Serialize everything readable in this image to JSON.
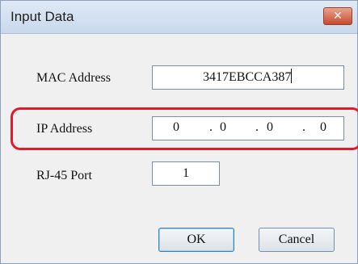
{
  "window": {
    "title": "Input Data",
    "close_glyph": "✕"
  },
  "form": {
    "mac": {
      "label": "MAC Address",
      "value": "3417EBCCA387"
    },
    "ip": {
      "label": "IP Address",
      "octets": [
        "0",
        "0",
        "0",
        "0"
      ],
      "separator": "."
    },
    "rj45": {
      "label": "RJ-45 Port",
      "value": "1"
    }
  },
  "buttons": {
    "ok": "OK",
    "cancel": "Cancel"
  },
  "colors": {
    "highlight": "#e21b2b",
    "close_button": "#c74a30"
  }
}
